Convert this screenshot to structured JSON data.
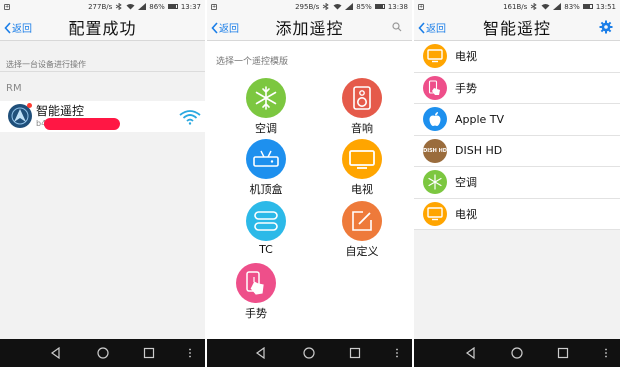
{
  "screens": [
    {
      "status": {
        "speed": "277B/s",
        "battery": "86%",
        "time": "13:37",
        "battery_level": 0.86
      },
      "header": {
        "back_label": "返回",
        "title": "配置成功"
      },
      "hint": "选择一台设备进行操作",
      "group_label": "RM",
      "device": {
        "name": "智能遥控",
        "id_prefix": "b4"
      }
    },
    {
      "status": {
        "speed": "295B/s",
        "battery": "85%",
        "time": "13:38",
        "battery_level": 0.85
      },
      "header": {
        "back_label": "返回",
        "title": "添加遥控"
      },
      "hint": "选择一个遥控模版",
      "templates": [
        {
          "label": "空调",
          "color": "#7cc740",
          "icon": "snowflake-icon"
        },
        {
          "label": "音响",
          "color": "#e55a4a",
          "icon": "speaker-icon"
        },
        {
          "label": "机顶盒",
          "color": "#1e90ee",
          "icon": "settop-box-icon"
        },
        {
          "label": "电视",
          "color": "#ffa500",
          "icon": "tv-icon"
        },
        {
          "label": "TC",
          "color": "#2cb9e8",
          "icon": "tc-icon"
        },
        {
          "label": "自定义",
          "color": "#ee7a3a",
          "icon": "edit-icon"
        },
        {
          "label": "手势",
          "color": "#ee4f8a",
          "icon": "gesture-icon"
        }
      ]
    },
    {
      "status": {
        "speed": "161B/s",
        "battery": "83%",
        "time": "13:51",
        "battery_level": 0.83
      },
      "header": {
        "back_label": "返回",
        "title": "智能遥控"
      },
      "items": [
        {
          "label": "电视",
          "color": "#ffa500",
          "icon": "tv-icon"
        },
        {
          "label": "手势",
          "color": "#ee4f8a",
          "icon": "gesture-icon"
        },
        {
          "label": "Apple TV",
          "color": "#1e90ee",
          "icon": "apple-icon"
        },
        {
          "label": "DISH HD",
          "color": "#9a6c3c",
          "icon": "dish-icon",
          "icon_text": "DISH HD"
        },
        {
          "label": "空调",
          "color": "#7cc740",
          "icon": "snowflake-icon"
        },
        {
          "label": "电视",
          "color": "#ffa500",
          "icon": "tv-icon"
        }
      ]
    }
  ]
}
